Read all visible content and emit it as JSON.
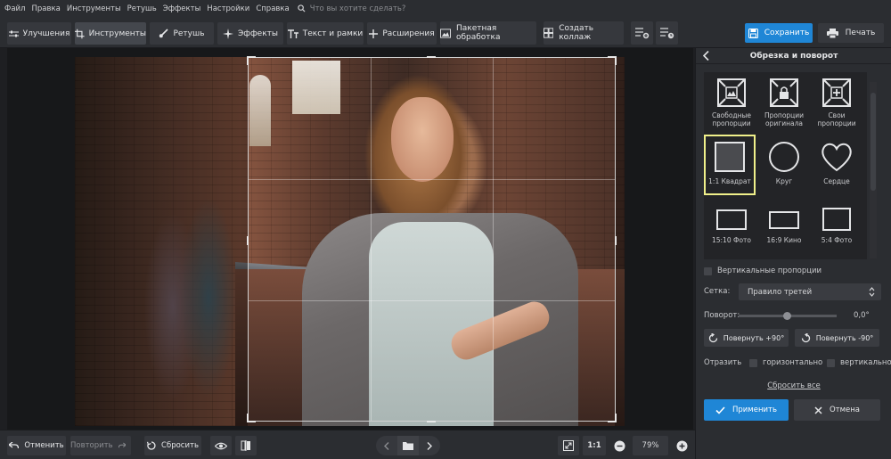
{
  "menu": {
    "items": [
      "Файл",
      "Правка",
      "Инструменты",
      "Ретушь",
      "Эффекты",
      "Настройки",
      "Справка"
    ],
    "search_placeholder": "Что вы хотите сделать?"
  },
  "toolbar": {
    "tabs": [
      {
        "label": "Улучшения",
        "icon": "sliders-icon"
      },
      {
        "label": "Инструменты",
        "icon": "crop-icon"
      },
      {
        "label": "Ретушь",
        "icon": "brush-icon"
      },
      {
        "label": "Эффекты",
        "icon": "sparkle-icon"
      },
      {
        "label": "Текст и рамки",
        "icon": "text-icon"
      },
      {
        "label": "Расширения",
        "icon": "plus-icon"
      }
    ],
    "batch_label": "Пакетная обработка",
    "collage_label": "Создать коллаж",
    "save_label": "Сохранить",
    "print_label": "Печать"
  },
  "status": {
    "undo_label": "Отменить",
    "redo_label": "Повторить",
    "reset_label": "Сбросить",
    "zoom_fit_label": "1:1",
    "zoom_value": "79%"
  },
  "panel": {
    "title": "Обрезка и поворот",
    "shapes": [
      {
        "label": "Свободные пропорции",
        "icon": "free-ratio-icon"
      },
      {
        "label": "Пропорции оригинала",
        "icon": "lock-ratio-icon"
      },
      {
        "label": "Свои пропорции",
        "icon": "custom-ratio-icon"
      },
      {
        "label": "1:1 Квадрат",
        "icon": "square-icon",
        "selected": true
      },
      {
        "label": "Круг",
        "icon": "circle-icon"
      },
      {
        "label": "Сердце",
        "icon": "heart-icon"
      },
      {
        "label": "15:10 Фото",
        "icon": "rect-15-10-icon"
      },
      {
        "label": "16:9 Кино",
        "icon": "rect-16-9-icon"
      },
      {
        "label": "5:4 Фото",
        "icon": "rect-5-4-icon"
      }
    ],
    "vertical_label": "Вертикальные пропорции",
    "grid_label": "Сетка:",
    "grid_value": "Правило третей",
    "rotation_label": "Поворот:",
    "rotation_value": "0,0°",
    "rotate_plus_label": "Повернуть +90°",
    "rotate_minus_label": "Повернуть -90°",
    "flip_label": "Отразить",
    "flip_h_label": "горизонтально",
    "flip_v_label": "вертикально",
    "reset_all_label": "Сбросить все",
    "apply_label": "Применить",
    "cancel_label": "Отмена"
  },
  "colors": {
    "accent": "#1f86d6",
    "selected_border": "#f0f08a",
    "background": "#2b2d31"
  }
}
